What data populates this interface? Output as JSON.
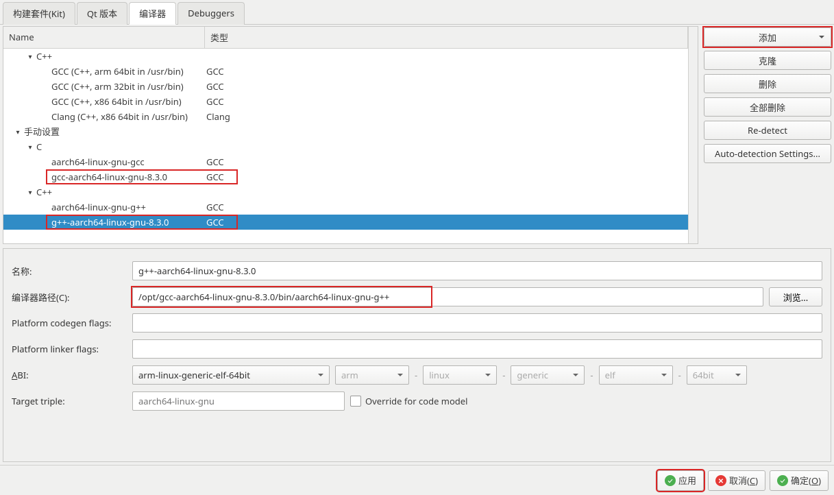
{
  "tabs": {
    "kits": "构建套件(Kit)",
    "qt": "Qt 版本",
    "compilers": "编译器",
    "debuggers": "Debuggers"
  },
  "tree": {
    "headers": {
      "name": "Name",
      "type": "类型"
    },
    "cxx_group": "C++",
    "rows": {
      "gcc_arm64": {
        "name": "GCC (C++, arm 64bit in /usr/bin)",
        "type": "GCC"
      },
      "gcc_arm32": {
        "name": "GCC (C++, arm 32bit in /usr/bin)",
        "type": "GCC"
      },
      "gcc_x8664": {
        "name": "GCC (C++, x86 64bit in /usr/bin)",
        "type": "GCC"
      },
      "clang_x8664": {
        "name": "Clang (C++, x86 64bit in /usr/bin)",
        "type": "Clang"
      }
    },
    "manual_group": "手动设置",
    "c_group": "C",
    "manual_c": {
      "aarch64_gcc": {
        "name": "aarch64-linux-gnu-gcc",
        "type": "GCC"
      },
      "gcc830": {
        "name": "gcc-aarch64-linux-gnu-8.3.0",
        "type": "GCC"
      }
    },
    "manual_cxx_group": "C++",
    "manual_cxx": {
      "aarch64_gpp": {
        "name": "aarch64-linux-gnu-g++",
        "type": "GCC"
      },
      "gpp830": {
        "name": "g++-aarch64-linux-gnu-8.3.0",
        "type": "GCC"
      }
    }
  },
  "buttons": {
    "add": "添加",
    "clone": "克隆",
    "delete": "删除",
    "deleteAll": "全部删除",
    "redetect": "Re-detect",
    "autodetect": "Auto-detection Settings..."
  },
  "details": {
    "name_label": "名称:",
    "name_value": "g++-aarch64-linux-gnu-8.3.0",
    "path_label": "编译器路径(C):",
    "path_value": "/opt/gcc-aarch64-linux-gnu-8.3.0/bin/aarch64-linux-gnu-g++",
    "browse": "浏览...",
    "codegen_label": "Platform codegen flags:",
    "codegen_value": "",
    "linker_label": "Platform linker flags:",
    "linker_value": "",
    "abi_label": "ABI:",
    "abi": {
      "full": "arm-linux-generic-elf-64bit",
      "arch": "arm",
      "os": "linux",
      "flavor": "generic",
      "format": "elf",
      "width": "64bit"
    },
    "target_label": "Target triple:",
    "target_placeholder": "aarch64-linux-gnu",
    "override_checkbox": "Override for code model"
  },
  "bottom": {
    "apply": "应用",
    "cancel": "取消(C)",
    "ok": "确定(O)"
  }
}
